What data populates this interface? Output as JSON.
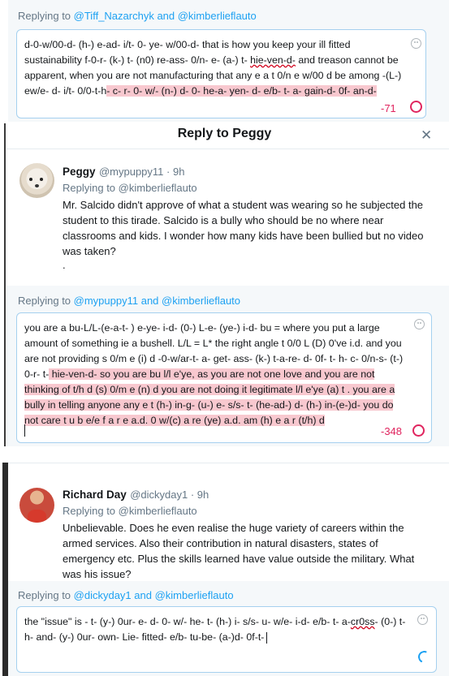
{
  "panel1": {
    "reply_prefix": "Replying to ",
    "reply_mentions": "@Tiff_Nazarchyk and @kimberlieflauto",
    "text_plain": "d-0-w/00-d- (h-) e-ad- i/t- 0- ye- w/00-d-  that is how you keep your ill fitted sustainability f-0-r- (k-) t- (n0) re-ass- 0/n- e- (a-) t- ",
    "text_squig": "hie-ven-d-",
    "text_plain2": "  and treason cannot be apparent, when you are not manufacturing that any e a t 0/n e w/00 d  be among -(L-) ew/e- d- i/t- 0/0-t-h",
    "text_hl": "- c- r- 0- w/- (n-) d-  0- he-a- yen- d- e/b- t- a- gain-d- 0f- an-d-",
    "counter": "-71"
  },
  "dialog": {
    "title": "Reply to Peggy",
    "close_icon": "close-icon"
  },
  "peggy": {
    "name": "Peggy",
    "handle": "@mypuppy11 · 9h",
    "replying": "Replying to @kimberlieflauto",
    "text": "Mr. Salcido didn't approve of what a student was wearing so he subjected the student to this tirade.  Salcido is a bully who should be no where near classrooms and kids.  I wonder how many kids have been bullied but no video was taken?",
    "dot": "."
  },
  "panel2": {
    "reply_prefix": "Replying to ",
    "reply_mentions": "@mypuppy11 and @kimberlieflauto",
    "text_plain": "you are a bu-L/L-(e-a-t- ) e-ye- i-d- (0-) L-e- (ye-) i-d-  bu = where you put a large amount of something ie a bushell. L/L = L* the right angle t 0/0 L (D) 0've i.d.  and you are not providing s 0/m e (i) d -0-w/ar-t- a- get- ass- (k-) t-a-re- d- 0f- t- h- c- 0/n-s- (t-) 0-r- t-",
    "text_hl": " hie-ven-d-   so you are bu l/l e'ye, as you are not one love and you are not thinking of  t/h d (s) 0/m e (n) d   you are not doing it legitimate l/l e'ye (a) t . you are a bully in telling anyone any e t (h-) in-g- (u-) e- s/s- t- (he-ad-) d- (h-) in-(e-)d-    you do not care  t u b e/e f a r e a.d.  0 w/(c) a re (ye) a.d. am (h) e a r (t/h) d",
    "counter": "-348"
  },
  "richard": {
    "name": "Richard Day",
    "handle": "@dickyday1 · 9h",
    "replying": "Replying to @kimberlieflauto",
    "text": "Unbelievable.  Does he even realise the huge variety of careers within the armed services.  Also their contribution in natural disasters,  states of emergency etc. Plus the skills learned have value outside the military.   What was his issue?"
  },
  "panel3": {
    "reply_prefix": "Replying to ",
    "reply_mentions": "@dickyday1 and @kimberlieflauto",
    "text_plain": "the \"issue\"  is  - t- (y-) 0ur- e- d- 0- w/- he- t- (h-) i- s/s- u- w/e-  i-d- e/b-  t- a-",
    "text_squig": "cr0ss",
    "text_plain2": "- (0-) t-  h- and- (y-) 0ur-  own- Lie- fitted- e/b- tu-be- (a-)d- 0f-t-"
  },
  "colors": {
    "accent": "#1da1f2",
    "highlight": "#f8c8cf",
    "error": "#e0245e"
  }
}
